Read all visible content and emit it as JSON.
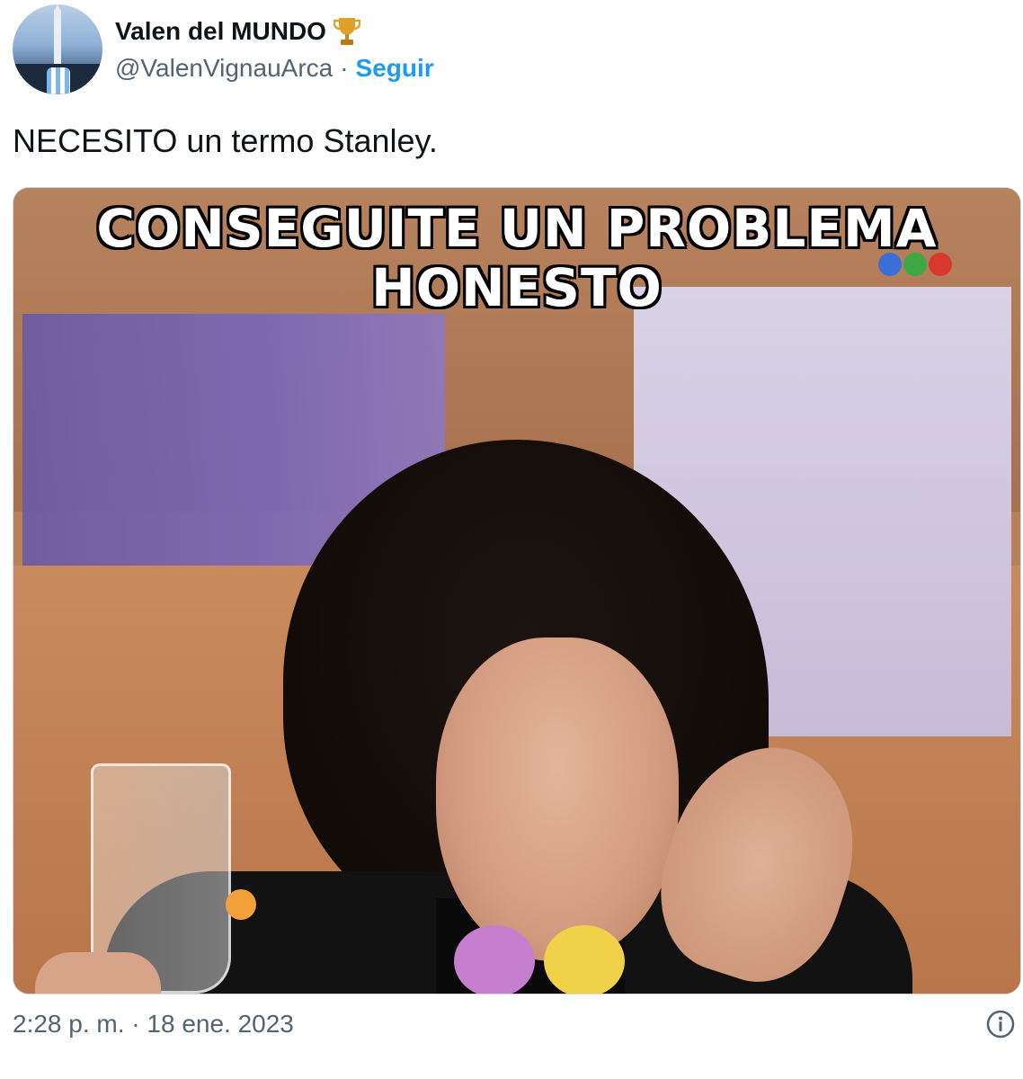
{
  "author": {
    "display_name": "Valen del MUNDO",
    "handle": "@ValenVignauArca",
    "separator": "·",
    "follow_label": "Seguir",
    "badge_icon": "trophy-icon"
  },
  "tweet": {
    "text": "NECESITO un termo Stanley.",
    "timestamp": "2:28 p. m. · 18 ene. 2023"
  },
  "media": {
    "caption_line1": "CONSEGUITE UN PROBLEMA",
    "caption_line2": "HONESTO"
  },
  "colors": {
    "link": "#1d9bf0",
    "secondary_text": "#536471",
    "primary_text": "#0f1419"
  }
}
